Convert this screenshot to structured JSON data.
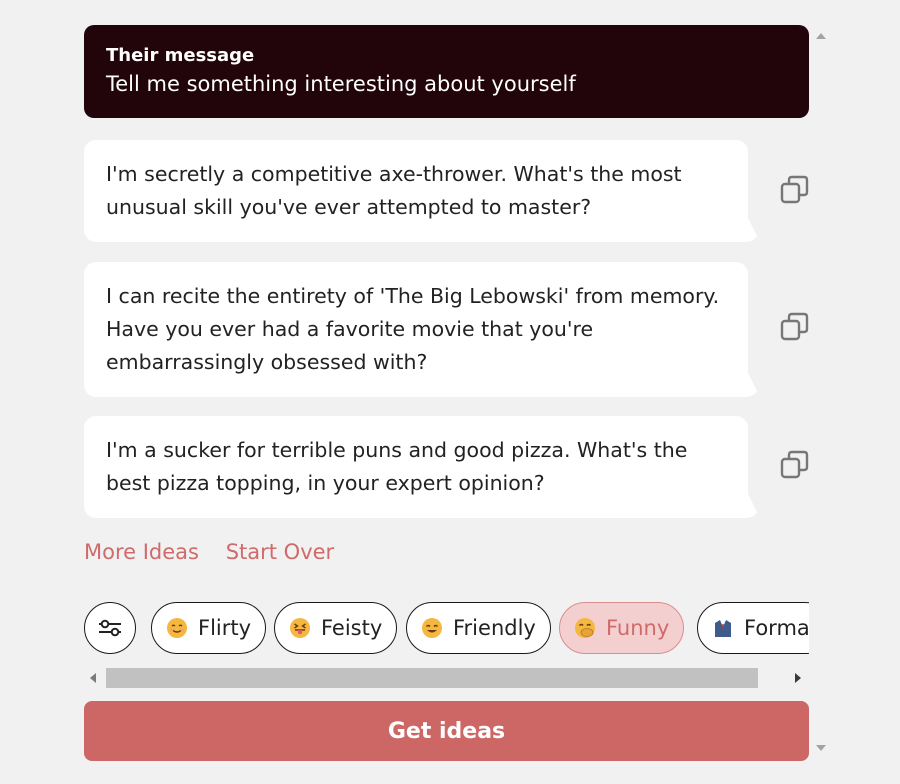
{
  "their_message": {
    "label": "Their message",
    "text": "Tell me something interesting about yourself"
  },
  "suggestions": [
    {
      "text": "I'm secretly a competitive axe-thrower. What's the most unusual skill you've ever attempted to master?",
      "icon": "copy-icon"
    },
    {
      "text": "I can recite the entirety of 'The Big Lebowski' from memory. Have you ever had a favorite movie that you're embarrassingly obsessed with?",
      "icon": "copy-icon"
    },
    {
      "text": "I'm a sucker for terrible puns and good pizza. What's the best pizza topping, in your expert opinion?",
      "icon": "copy-icon"
    }
  ],
  "links": {
    "more_ideas": "More Ideas",
    "start_over": "Start Over"
  },
  "tones": [
    {
      "label": "Flirty",
      "icon": "smiling-face-emoji"
    },
    {
      "label": "Feisty",
      "icon": "winking-tongue-emoji"
    },
    {
      "label": "Friendly",
      "icon": "smiling-eyes-emoji"
    },
    {
      "label": "Funny",
      "icon": "hand-over-mouth-emoji",
      "selected": true
    },
    {
      "label": "Formal",
      "icon": "suit-emoji"
    }
  ],
  "get_ideas_label": "Get ideas",
  "colors": {
    "header_bg": "#22050a",
    "accent": "#cd6765",
    "link": "#cf6b6a",
    "selected_chip_bg": "#f3cfcf",
    "background": "#f1f1f1"
  }
}
